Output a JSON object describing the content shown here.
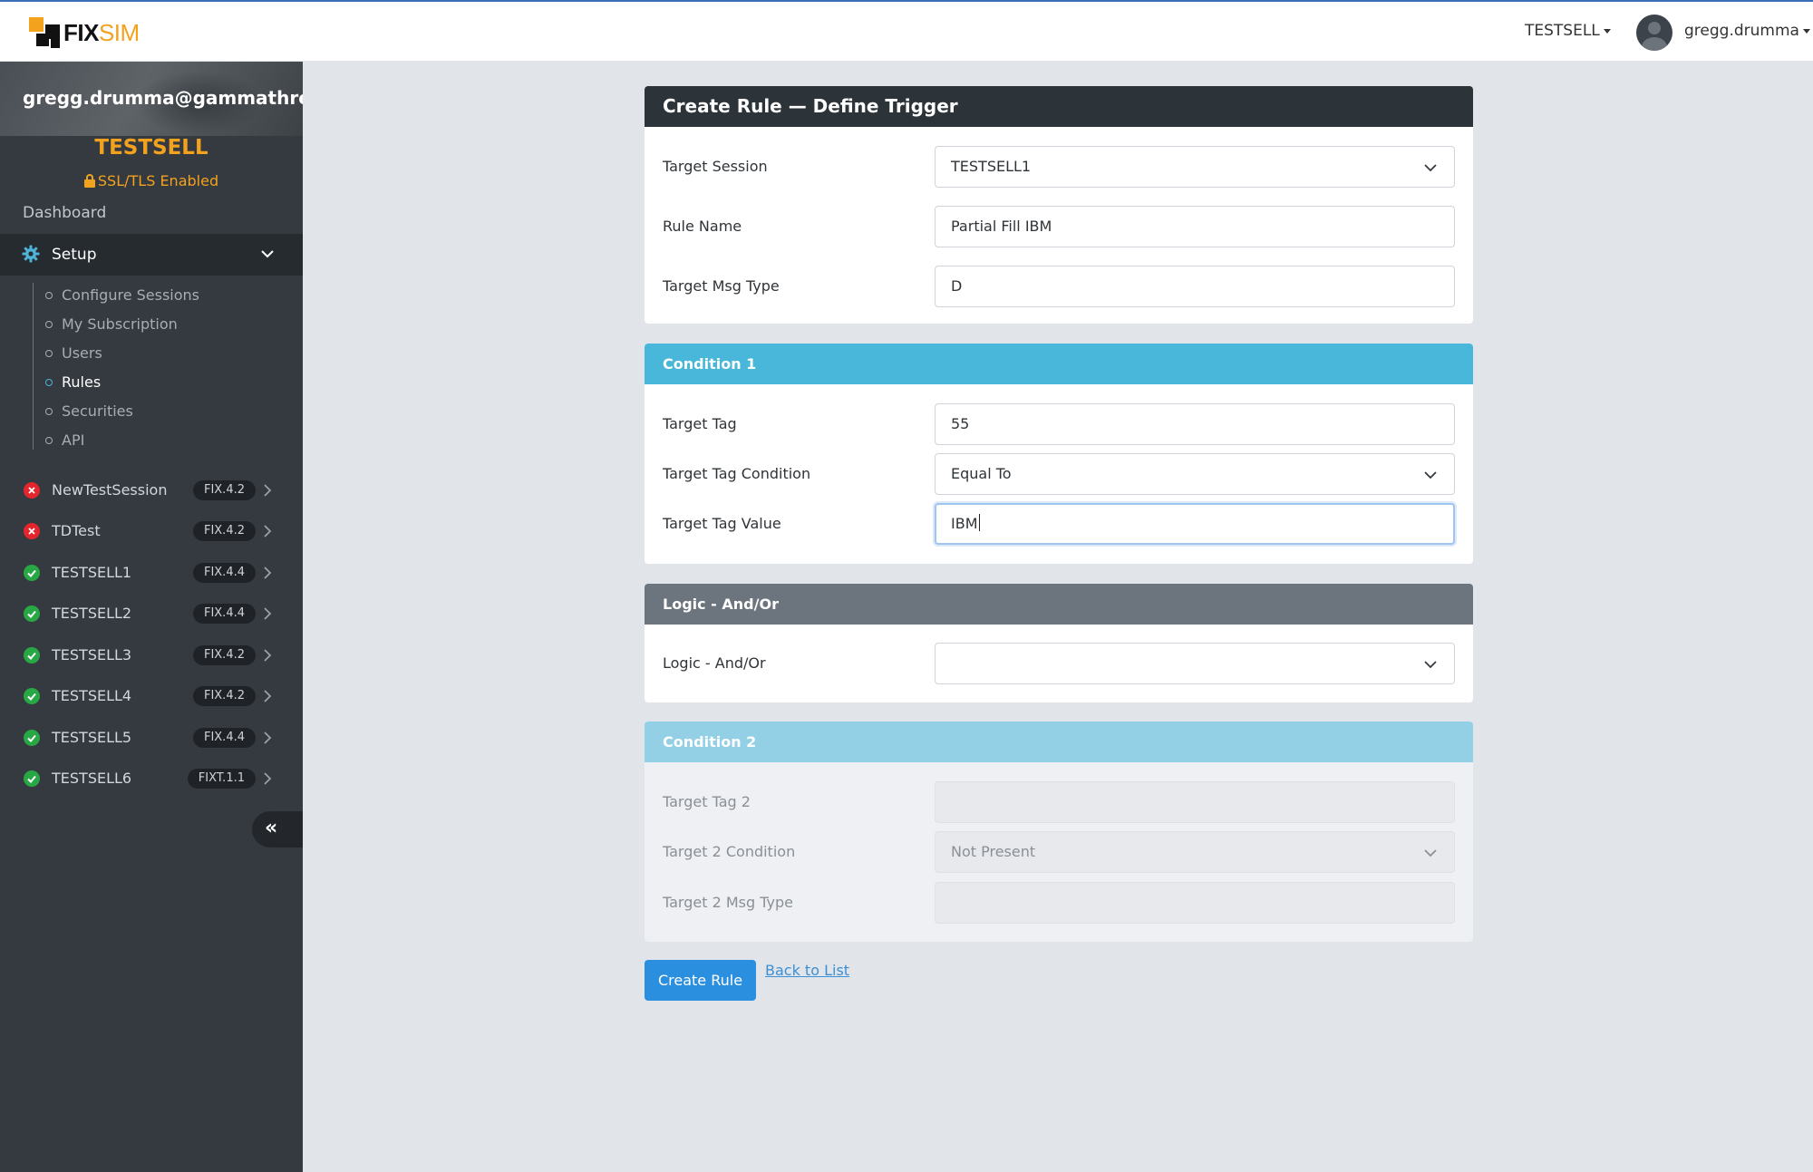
{
  "brand": {
    "logo_fix": "FIX",
    "logo_sim": "SIM"
  },
  "topbar": {
    "environment": "TESTSELL",
    "username": "gregg.drumma"
  },
  "sidebar": {
    "email": "gregg.drumma@gammathreetradi",
    "environment": "TESTSELL",
    "ssl_label": "SSL/TLS Enabled",
    "dashboard": "Dashboard",
    "setup": "Setup",
    "setup_items": [
      {
        "label": "Configure Sessions",
        "active": false
      },
      {
        "label": "My Subscription",
        "active": false
      },
      {
        "label": "Users",
        "active": false
      },
      {
        "label": "Rules",
        "active": true
      },
      {
        "label": "Securities",
        "active": false
      },
      {
        "label": "API",
        "active": false
      }
    ],
    "sessions": [
      {
        "name": "NewTestSession",
        "version": "FIX.4.2",
        "status": "error"
      },
      {
        "name": "TDTest",
        "version": "FIX.4.2",
        "status": "error"
      },
      {
        "name": "TESTSELL1",
        "version": "FIX.4.4",
        "status": "ok"
      },
      {
        "name": "TESTSELL2",
        "version": "FIX.4.4",
        "status": "ok"
      },
      {
        "name": "TESTSELL3",
        "version": "FIX.4.2",
        "status": "ok"
      },
      {
        "name": "TESTSELL4",
        "version": "FIX.4.2",
        "status": "ok"
      },
      {
        "name": "TESTSELL5",
        "version": "FIX.4.4",
        "status": "ok"
      },
      {
        "name": "TESTSELL6",
        "version": "FIXT.1.1",
        "status": "ok"
      }
    ],
    "collapse_icon": "«"
  },
  "trigger": {
    "title": "Create Rule — Define Trigger",
    "target_session_label": "Target Session",
    "target_session_value": "TESTSELL1",
    "rule_name_label": "Rule Name",
    "rule_name_value": "Partial Fill IBM",
    "msg_type_label": "Target Msg Type",
    "msg_type_value": "D"
  },
  "condition1": {
    "title": "Condition 1",
    "tag_label": "Target Tag",
    "tag_value": "55",
    "condition_label": "Target Tag Condition",
    "condition_value": "Equal To",
    "value_label": "Target Tag Value",
    "value_value": "IBM"
  },
  "logic": {
    "title": "Logic - And/Or",
    "label": "Logic - And/Or",
    "value": ""
  },
  "condition2": {
    "title": "Condition 2",
    "tag_label": "Target Tag 2",
    "tag_value": "",
    "condition_label": "Target 2 Condition",
    "condition_value": "Not Present",
    "msg_type_label": "Target 2 Msg Type",
    "msg_type_value": ""
  },
  "actions": {
    "create_label": "Create Rule",
    "back_label": "Back to List"
  },
  "colors": {
    "accent_orange": "#f3a21d",
    "primary_blue": "#2b8fe0",
    "info": "#49b7d9",
    "sidebar_bg": "#343a40",
    "ok": "#28a745",
    "error": "#e3262d"
  }
}
